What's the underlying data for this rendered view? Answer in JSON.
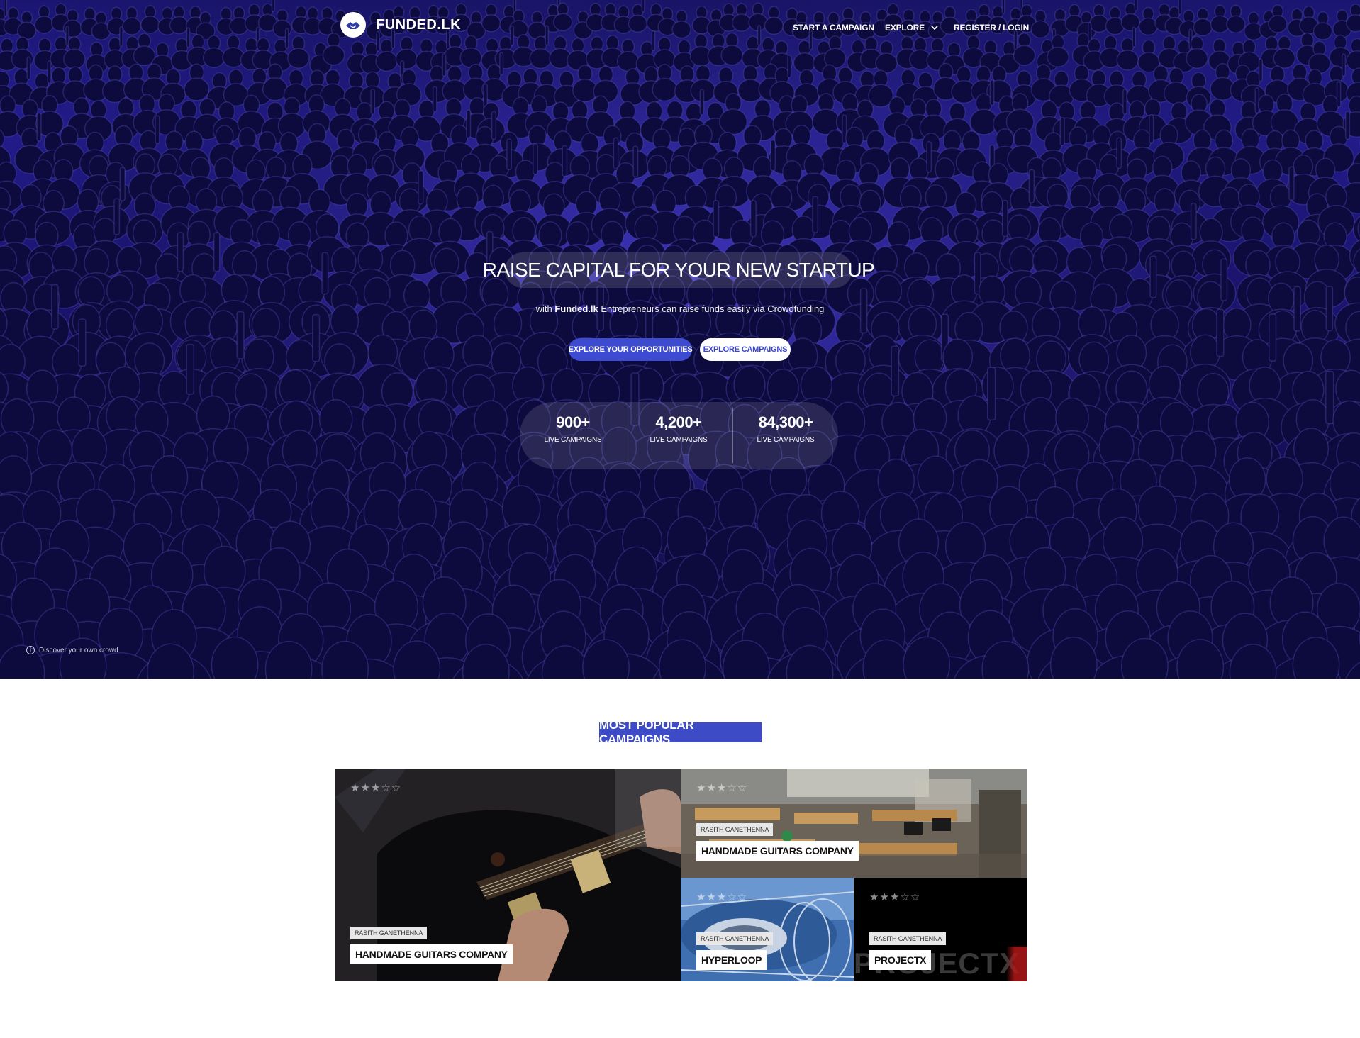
{
  "header": {
    "brand": "FUNDED.LK",
    "nav": {
      "start_campaign": "START A CAMPAIGN",
      "explore": "EXPLORE",
      "register_login": "REGISTER / LOGIN"
    }
  },
  "hero": {
    "headline": "RAISE CAPITAL FOR YOUR NEW STARTUP",
    "subline_prefix": "with",
    "subline_brand": "Funded.lk",
    "subline_suffix": "Entrepreneurs can raise funds easily via Crowdfunding",
    "primary_button": "EXPLORE YOUR OPPORTUNITIES",
    "secondary_button": "EXPLORE CAMPAIGNS",
    "stats": [
      {
        "value": "900+",
        "label": "LIVE CAMPAIGNS"
      },
      {
        "value": "4,200+",
        "label": "LIVE CAMPAIGNS"
      },
      {
        "value": "84,300+",
        "label": "LIVE CAMPAIGNS"
      }
    ],
    "credit": "Discover your own crowd"
  },
  "popular": {
    "title": "MOST POPULAR CAMPAIGNS",
    "cards": [
      {
        "stars": "★★★☆☆",
        "author": "RASITH GANETHENNA",
        "title": "HANDMADE GUITARS COMPANY",
        "rating": 3
      },
      {
        "stars": "★★★☆☆",
        "author": "RASITH GANETHENNA",
        "title": "HANDMADE GUITARS COMPANY",
        "rating": 3
      },
      {
        "stars": "★★★☆☆",
        "author": "RASITH GANETHENNA",
        "title": "HYPERLOOP",
        "rating": 3
      },
      {
        "stars": "★★★☆☆",
        "author": "RASITH GANETHENNA",
        "title": "PROJECTX",
        "rating": 3
      }
    ],
    "projectx_logo": "PROJECTX"
  },
  "colors": {
    "accent": "#3d4bd1",
    "section_title_bg": "#3d4bc6",
    "hero_dark": "#120e52"
  }
}
